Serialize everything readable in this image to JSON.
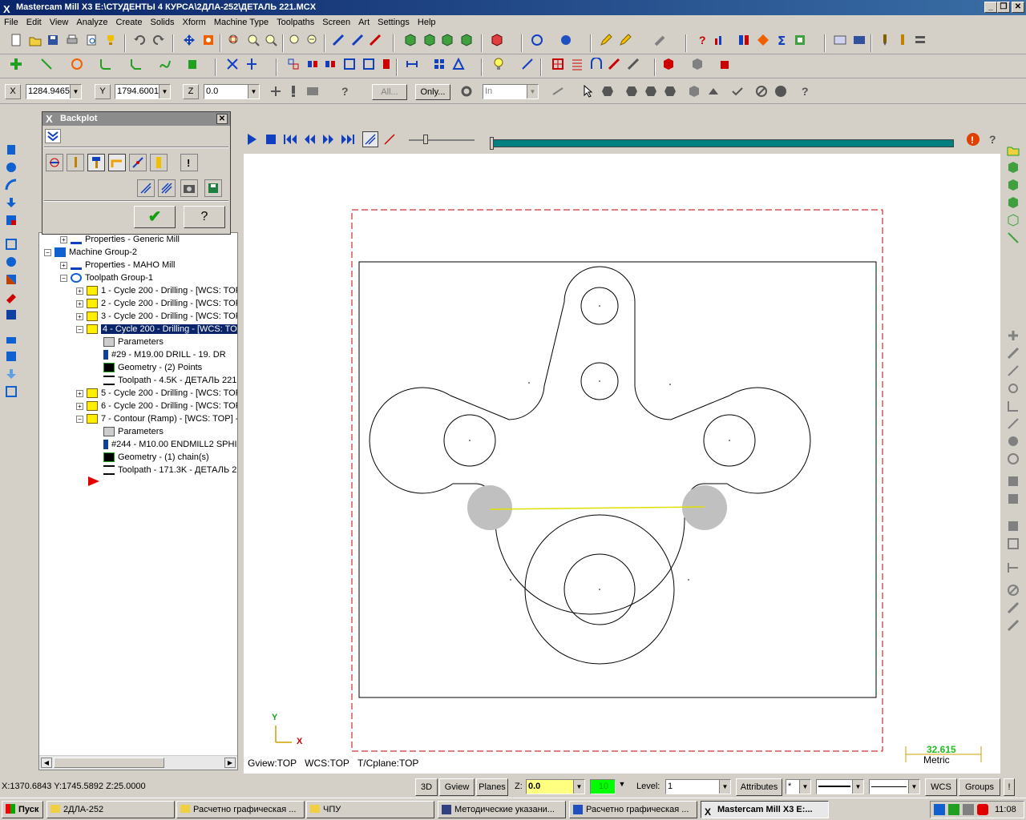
{
  "window": {
    "title": "Mastercam Mill X3  E:\\СТУДЕНТЫ 4 КУРСА\\2ДЛА-252\\ДЕТАЛЬ 221.MCX",
    "min": "_",
    "restore": "❐",
    "close": "✕"
  },
  "menu": [
    "File",
    "Edit",
    "View",
    "Analyze",
    "Create",
    "Solids",
    "Xform",
    "Machine Type",
    "Toolpaths",
    "Screen",
    "Art",
    "Settings",
    "Help"
  ],
  "coords": {
    "x_label": "X",
    "x_value": "1284.9465",
    "y_label": "Y",
    "y_value": "1794.6001",
    "z_label": "Z",
    "z_value": "0.0",
    "all_btn": "All...",
    "only_btn": "Only...",
    "in_value": "In"
  },
  "backplot": {
    "title": "Backplot",
    "ok": "✔",
    "help": "?"
  },
  "tree": {
    "items": [
      {
        "text": "Properties - Generic Mill",
        "level": 2
      },
      {
        "text": "Machine Group-2",
        "level": 0
      },
      {
        "text": "Properties - MAHO Mill",
        "level": 1
      },
      {
        "text": "Toolpath Group-1",
        "level": 1
      },
      {
        "text": "1 - Cycle 200 - Drilling - [WCS: TOP",
        "level": 2
      },
      {
        "text": "2 - Cycle 200 - Drilling - [WCS: TOP",
        "level": 2
      },
      {
        "text": "3 - Cycle 200 - Drilling - [WCS: TOP",
        "level": 2
      },
      {
        "text": "4 - Cycle 200 - Drilling - [WCS: TOP",
        "level": 2,
        "selected": true
      },
      {
        "text": "Parameters",
        "level": 3
      },
      {
        "text": "#29 - M19.00 DRILL -     19. DR",
        "level": 3
      },
      {
        "text": "Geometry - (2) Points",
        "level": 3
      },
      {
        "text": "Toolpath - 4.5K - ДЕТАЛЬ 221",
        "level": 3
      },
      {
        "text": "5 - Cycle 200 - Drilling - [WCS: TOP",
        "level": 2
      },
      {
        "text": "6 - Cycle 200 - Drilling - [WCS: TOP",
        "level": 2
      },
      {
        "text": "7 - Contour (Ramp) - [WCS: TOP] -",
        "level": 2
      },
      {
        "text": "Parameters",
        "level": 3
      },
      {
        "text": "#244 - M10.00 ENDMILL2 SPHI",
        "level": 3
      },
      {
        "text": "Geometry - (1) chain(s)",
        "level": 3
      },
      {
        "text": "Toolpath - 171.3K - ДЕТАЛЬ 22",
        "level": 3
      }
    ]
  },
  "viewport": {
    "gview": "Gview:TOP",
    "wcs": "WCS:TOP",
    "tcplane": "T/Cplane:TOP",
    "axis_y": "Y",
    "axis_x": "X",
    "scale_value": "32.615",
    "scale_unit": "Metric"
  },
  "status": {
    "coords": "X:1370.6843   Y:1745.5892  Z:25.0000",
    "btn_3d": "3D",
    "gview": "Gview",
    "planes": "Planes",
    "z_label": "Z:",
    "z_value": "0.0",
    "level_num": "10",
    "level_label": "Level:",
    "level_value": "1",
    "attributes": "Attributes",
    "attr_star": "*",
    "wcs": "WCS",
    "groups": "Groups",
    "bang": "!"
  },
  "taskbar": {
    "start": "Пуск",
    "tasks": [
      "2ДЛА-252",
      "Расчетно графическая ...",
      "ЧПУ",
      "Методические указани...",
      "Расчетно графическая ...",
      "Mastercam Mill X3  E:..."
    ],
    "clock": "11:08"
  },
  "colors": {
    "title": "#0a246a",
    "progress": "#008080",
    "selected": "#0a246a",
    "stock": "#c00000",
    "toolpath": "#e0e000"
  }
}
